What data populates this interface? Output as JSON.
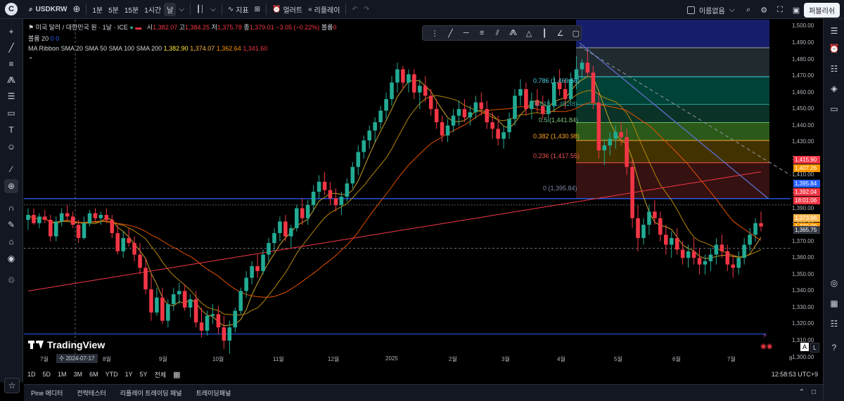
{
  "toolbar": {
    "logo_letter": "C",
    "symbol": "USDKRW",
    "intervals": [
      "1분",
      "5분",
      "15분",
      "1시간",
      "날"
    ],
    "active_interval": "날",
    "indicators_label": "지표",
    "alert_label": "얼러트",
    "replay_label": "리플레이",
    "layout_name": "이름없음",
    "publish_label": "퍼블리쉬"
  },
  "legend": {
    "title": "미국 달러 / 대한민국 원 · 1날 · ICE",
    "open_label": "시",
    "open": "1,382.07",
    "high_label": "고",
    "high": "1,384.25",
    "low_label": "저",
    "low": "1,375.78",
    "close_label": "종",
    "close": "1,379.01",
    "change": "−3.05 (−0.22%)",
    "volume_label": "볼륨",
    "volume": "0",
    "volume2_label": "볼륨 20",
    "volume2": "0 0",
    "ma_label": "MA Ribbon",
    "ma_desc": "SMA 20 SMA 50 SMA 100 SMA 200",
    "ma_vals": [
      "1,382.90",
      "1,374.07",
      "1,362.64",
      "1,341.60"
    ]
  },
  "fib": {
    "labels": [
      "0.786 (1,469.56)",
      "0.618 (1,452.8)",
      "0.5 (1,441.84)",
      "0.382 (1,430.98)",
      "0.236 (1,417.55)",
      "0 (1,395.84)"
    ]
  },
  "price_axis": {
    "ticks": [
      "1,500.00",
      "1,490.00",
      "1,480.00",
      "1,470.00",
      "1,460.00",
      "1,450.00",
      "1,440.00",
      "1,430.00",
      "1,420.00",
      "1,410.00",
      "1,400.00",
      "1,390.00",
      "1,380.00",
      "1,370.00",
      "1,360.00",
      "1,350.00",
      "1,340.00",
      "1,330.00",
      "1,320.00",
      "1,310.00",
      "1,300.00"
    ],
    "tags": [
      {
        "text": "1,415.90",
        "color": "#f23645"
      },
      {
        "text": "1,407.26",
        "color": "#ff9800"
      },
      {
        "text": "1,395.84",
        "color": "#2962ff"
      },
      {
        "text": "1,392.04",
        "color": "#f23645"
      },
      {
        "text": "18:01:06",
        "color": "#f23645"
      },
      {
        "text": "1,373.96",
        "color": "#ffb74d"
      },
      {
        "text": "1,370.00",
        "color": "#ff9800"
      },
      {
        "text": "1,365.75",
        "color": "#363a45"
      }
    ]
  },
  "time_axis": {
    "labels": [
      "7월",
      "8월",
      "9월",
      "10월",
      "11월",
      "12월",
      "2025",
      "2월",
      "3월",
      "4월",
      "5월",
      "6월",
      "7월",
      "8"
    ],
    "highlight": "수 2024-07-17"
  },
  "ranges": [
    "1D",
    "5D",
    "1M",
    "3M",
    "6M",
    "YTD",
    "1Y",
    "5Y",
    "전체"
  ],
  "clock": "12:58:53 UTC+9",
  "bottom_tabs": [
    "Pine 에디터",
    "전략테스터",
    "리플레이 트레이딩 패널",
    "트레이딩패널"
  ],
  "watermark": "TradingView",
  "scale_buttons": [
    "A",
    "L"
  ],
  "chart_data": {
    "type": "candlestick",
    "ylim": [
      1296,
      1504
    ],
    "ohlc": [
      [
        1383,
        1390,
        1377,
        1386
      ],
      [
        1386,
        1390,
        1380,
        1381
      ],
      [
        1381,
        1387,
        1378,
        1385
      ],
      [
        1385,
        1389,
        1381,
        1383
      ],
      [
        1383,
        1386,
        1370,
        1373
      ],
      [
        1373,
        1385,
        1370,
        1382
      ],
      [
        1382,
        1390,
        1379,
        1387
      ],
      [
        1387,
        1392,
        1383,
        1385
      ],
      [
        1385,
        1388,
        1378,
        1380
      ],
      [
        1380,
        1383,
        1369,
        1372
      ],
      [
        1372,
        1385,
        1371,
        1381
      ],
      [
        1381,
        1389,
        1379,
        1387
      ],
      [
        1387,
        1390,
        1382,
        1384
      ],
      [
        1384,
        1388,
        1380,
        1386
      ],
      [
        1386,
        1390,
        1381,
        1383
      ],
      [
        1383,
        1386,
        1372,
        1375
      ],
      [
        1375,
        1380,
        1362,
        1364
      ],
      [
        1364,
        1376,
        1360,
        1372
      ],
      [
        1372,
        1378,
        1367,
        1369
      ],
      [
        1369,
        1373,
        1358,
        1362
      ],
      [
        1362,
        1369,
        1350,
        1354
      ],
      [
        1354,
        1360,
        1338,
        1341
      ],
      [
        1341,
        1350,
        1322,
        1327
      ],
      [
        1327,
        1342,
        1325,
        1336
      ],
      [
        1336,
        1342,
        1320,
        1322
      ],
      [
        1322,
        1335,
        1318,
        1332
      ],
      [
        1332,
        1342,
        1328,
        1338
      ],
      [
        1338,
        1345,
        1332,
        1340
      ],
      [
        1340,
        1344,
        1328,
        1330
      ],
      [
        1330,
        1338,
        1324,
        1335
      ],
      [
        1335,
        1340,
        1318,
        1321
      ],
      [
        1321,
        1330,
        1312,
        1316
      ],
      [
        1316,
        1328,
        1313,
        1325
      ],
      [
        1325,
        1332,
        1320,
        1326
      ],
      [
        1326,
        1331,
        1314,
        1318
      ],
      [
        1318,
        1325,
        1305,
        1310
      ],
      [
        1310,
        1322,
        1302,
        1318
      ],
      [
        1318,
        1330,
        1315,
        1328
      ],
      [
        1328,
        1342,
        1326,
        1340
      ],
      [
        1340,
        1352,
        1336,
        1348
      ],
      [
        1348,
        1358,
        1344,
        1355
      ],
      [
        1355,
        1362,
        1348,
        1352
      ],
      [
        1352,
        1365,
        1350,
        1362
      ],
      [
        1362,
        1372,
        1358,
        1369
      ],
      [
        1369,
        1378,
        1364,
        1375
      ],
      [
        1375,
        1385,
        1370,
        1382
      ],
      [
        1382,
        1386,
        1370,
        1373
      ],
      [
        1373,
        1380,
        1366,
        1378
      ],
      [
        1378,
        1392,
        1376,
        1390
      ],
      [
        1390,
        1396,
        1380,
        1384
      ],
      [
        1384,
        1395,
        1380,
        1392
      ],
      [
        1392,
        1404,
        1388,
        1400
      ],
      [
        1400,
        1410,
        1396,
        1406
      ],
      [
        1406,
        1412,
        1398,
        1401
      ],
      [
        1401,
        1406,
        1392,
        1396
      ],
      [
        1396,
        1402,
        1388,
        1392
      ],
      [
        1392,
        1400,
        1386,
        1397
      ],
      [
        1397,
        1408,
        1394,
        1405
      ],
      [
        1405,
        1418,
        1402,
        1415
      ],
      [
        1415,
        1428,
        1410,
        1424
      ],
      [
        1424,
        1434,
        1420,
        1431
      ],
      [
        1431,
        1440,
        1426,
        1437
      ],
      [
        1437,
        1445,
        1430,
        1442
      ],
      [
        1442,
        1452,
        1438,
        1449
      ],
      [
        1449,
        1460,
        1444,
        1456
      ],
      [
        1456,
        1470,
        1452,
        1466
      ],
      [
        1466,
        1478,
        1460,
        1474
      ],
      [
        1474,
        1476,
        1462,
        1466
      ],
      [
        1466,
        1474,
        1460,
        1471
      ],
      [
        1471,
        1474,
        1456,
        1460
      ],
      [
        1460,
        1468,
        1450,
        1464
      ],
      [
        1464,
        1470,
        1454,
        1458
      ],
      [
        1458,
        1462,
        1446,
        1450
      ],
      [
        1450,
        1456,
        1438,
        1442
      ],
      [
        1442,
        1446,
        1430,
        1434
      ],
      [
        1434,
        1444,
        1430,
        1440
      ],
      [
        1440,
        1450,
        1436,
        1446
      ],
      [
        1446,
        1455,
        1440,
        1450
      ],
      [
        1450,
        1456,
        1442,
        1445
      ],
      [
        1445,
        1452,
        1440,
        1448
      ],
      [
        1448,
        1458,
        1444,
        1454
      ],
      [
        1454,
        1460,
        1446,
        1450
      ],
      [
        1450,
        1455,
        1438,
        1442
      ],
      [
        1442,
        1448,
        1432,
        1438
      ],
      [
        1438,
        1446,
        1428,
        1432
      ],
      [
        1432,
        1440,
        1426,
        1436
      ],
      [
        1436,
        1448,
        1432,
        1444
      ],
      [
        1444,
        1462,
        1440,
        1458
      ],
      [
        1458,
        1468,
        1452,
        1462
      ],
      [
        1462,
        1466,
        1446,
        1450
      ],
      [
        1450,
        1460,
        1444,
        1455
      ],
      [
        1455,
        1462,
        1448,
        1452
      ],
      [
        1452,
        1458,
        1444,
        1447
      ],
      [
        1447,
        1456,
        1442,
        1452
      ],
      [
        1452,
        1470,
        1448,
        1466
      ],
      [
        1466,
        1474,
        1458,
        1462
      ],
      [
        1462,
        1468,
        1450,
        1456
      ],
      [
        1456,
        1472,
        1452,
        1468
      ],
      [
        1468,
        1482,
        1462,
        1474
      ],
      [
        1474,
        1480,
        1468,
        1478
      ],
      [
        1478,
        1486,
        1470,
        1472
      ],
      [
        1472,
        1476,
        1450,
        1454
      ],
      [
        1454,
        1460,
        1420,
        1425
      ],
      [
        1425,
        1432,
        1416,
        1428
      ],
      [
        1428,
        1436,
        1422,
        1432
      ],
      [
        1432,
        1440,
        1426,
        1436
      ],
      [
        1436,
        1442,
        1428,
        1433
      ],
      [
        1433,
        1438,
        1410,
        1415
      ],
      [
        1415,
        1420,
        1378,
        1384
      ],
      [
        1384,
        1392,
        1364,
        1372
      ],
      [
        1372,
        1384,
        1368,
        1380
      ],
      [
        1380,
        1392,
        1374,
        1388
      ],
      [
        1388,
        1395,
        1380,
        1384
      ],
      [
        1384,
        1388,
        1370,
        1374
      ],
      [
        1374,
        1380,
        1362,
        1368
      ],
      [
        1368,
        1376,
        1360,
        1372
      ],
      [
        1372,
        1378,
        1362,
        1365
      ],
      [
        1365,
        1370,
        1356,
        1360
      ],
      [
        1360,
        1368,
        1354,
        1364
      ],
      [
        1364,
        1372,
        1356,
        1360
      ],
      [
        1360,
        1366,
        1350,
        1356
      ],
      [
        1356,
        1362,
        1350,
        1358
      ],
      [
        1358,
        1366,
        1352,
        1362
      ],
      [
        1362,
        1372,
        1356,
        1368
      ],
      [
        1368,
        1374,
        1360,
        1364
      ],
      [
        1364,
        1368,
        1352,
        1356
      ],
      [
        1356,
        1362,
        1348,
        1354
      ],
      [
        1354,
        1364,
        1350,
        1360
      ],
      [
        1360,
        1372,
        1356,
        1368
      ],
      [
        1368,
        1378,
        1364,
        1374
      ],
      [
        1374,
        1384,
        1370,
        1381
      ],
      [
        1381,
        1388,
        1376,
        1379
      ]
    ]
  }
}
